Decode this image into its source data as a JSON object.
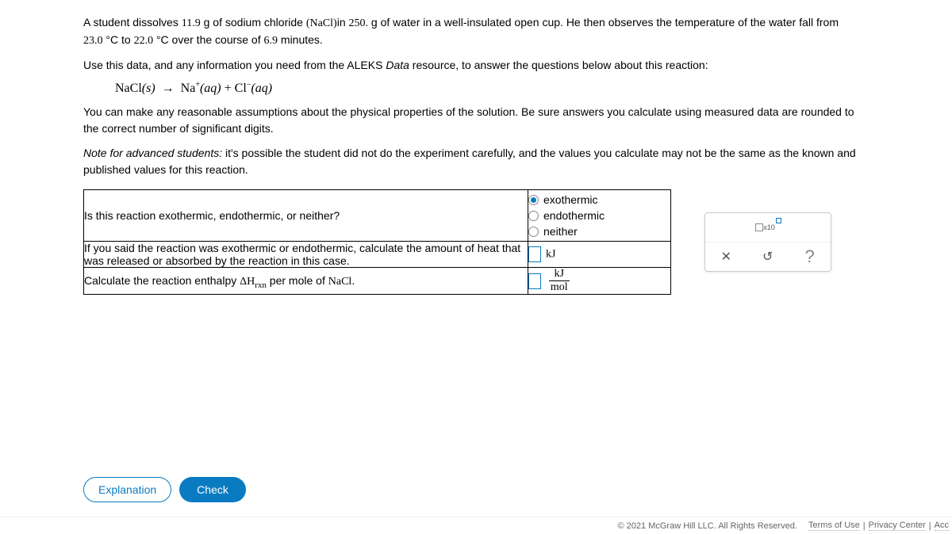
{
  "problem": {
    "p1_pre": "A student dissolves ",
    "mass_solute": "11.9",
    "p1_a": " g of sodium chloride ",
    "formula_inline": "(NaCl)",
    "p1_b": "in ",
    "mass_water": "250.",
    "p1_c": " g of water in a well-insulated open cup. He then observes the temperature of the water fall from",
    "p2_pre": "",
    "t_start": "23.0",
    "p2_a": " °C to ",
    "t_end": "22.0",
    "p2_b": " °C over the course of ",
    "duration": "6.9",
    "p2_c": " minutes.",
    "p3": "Use this data, and any information you need from the ALEKS ",
    "p3_link": "Data",
    "p3_b": " resource, to answer the questions below about this reaction:",
    "eq": {
      "lhs": "NaCl",
      "lhs_state": "(s)",
      "arrow": "→",
      "r1": "Na",
      "r1_sup": "+",
      "r1_state": "(aq)",
      "plus": " + ",
      "r2": "Cl",
      "r2_sup": "−",
      "r2_state": "(aq)"
    },
    "p4": "You can make any reasonable assumptions about the physical properties of the solution. Be sure answers you calculate using measured data are rounded to the correct number of significant digits.",
    "p5_label": "Note for advanced students:",
    "p5": " it's possible the student did not do the experiment carefully, and the values you calculate may not be the same as the known and published values for this reaction."
  },
  "questions": {
    "q1": "Is this reaction exothermic, endothermic, or neither?",
    "q1_opts": {
      "a": "exothermic",
      "b": "endothermic",
      "c": "neither"
    },
    "q2": "If you said the reaction was exothermic or endothermic, calculate the amount of heat that was released or absorbed by the reaction in this case.",
    "q2_unit": "kJ",
    "q3_pre": "Calculate the reaction enthalpy ",
    "q3_sym": "ΔH",
    "q3_sub": "rxn",
    "q3_post": " per mole of ",
    "q3_compound": "NaCl",
    "q3_end": ".",
    "q3_unit_num": "kJ",
    "q3_unit_den": "mol"
  },
  "palette": {
    "x10": "x10",
    "clear": "✕",
    "reset": "↻",
    "help": "?"
  },
  "buttons": {
    "explanation": "Explanation",
    "check": "Check"
  },
  "footer": {
    "copyright": "© 2021 McGraw Hill LLC. All Rights Reserved.",
    "terms": "Terms of Use",
    "privacy": "Privacy Center",
    "acc": "Acc"
  }
}
